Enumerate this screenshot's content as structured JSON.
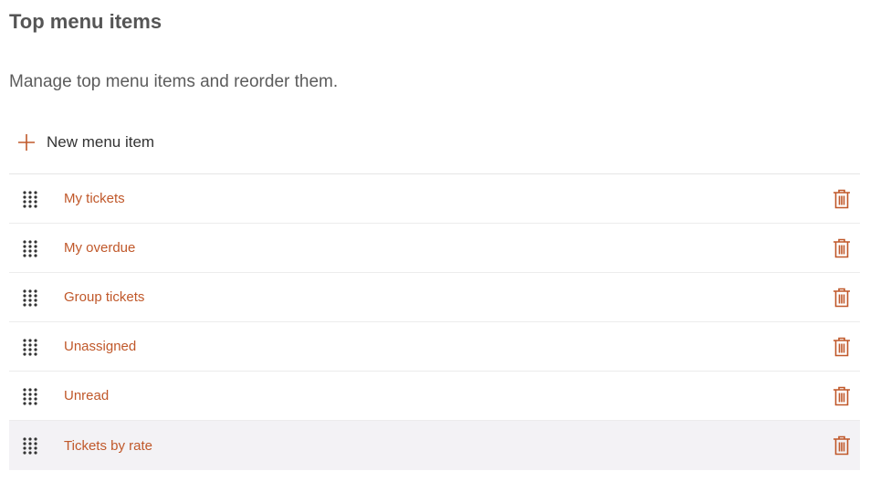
{
  "header": {
    "title": "Top menu items",
    "description": "Manage top menu items and reorder them."
  },
  "toolbar": {
    "new_item_label": "New menu item",
    "new_item_icon": "plus-icon"
  },
  "menu_items": [
    {
      "label": "My tickets"
    },
    {
      "label": "My overdue"
    },
    {
      "label": "Group tickets"
    },
    {
      "label": "Unassigned"
    },
    {
      "label": "Unread"
    },
    {
      "label": "Tickets by rate",
      "selected": true
    }
  ],
  "icons": {
    "drag": "drag-handle-icon",
    "delete": "trash-icon"
  },
  "colors": {
    "accent": "#c0582a",
    "title": "#555555",
    "selected_row": "#f3f2f5"
  }
}
